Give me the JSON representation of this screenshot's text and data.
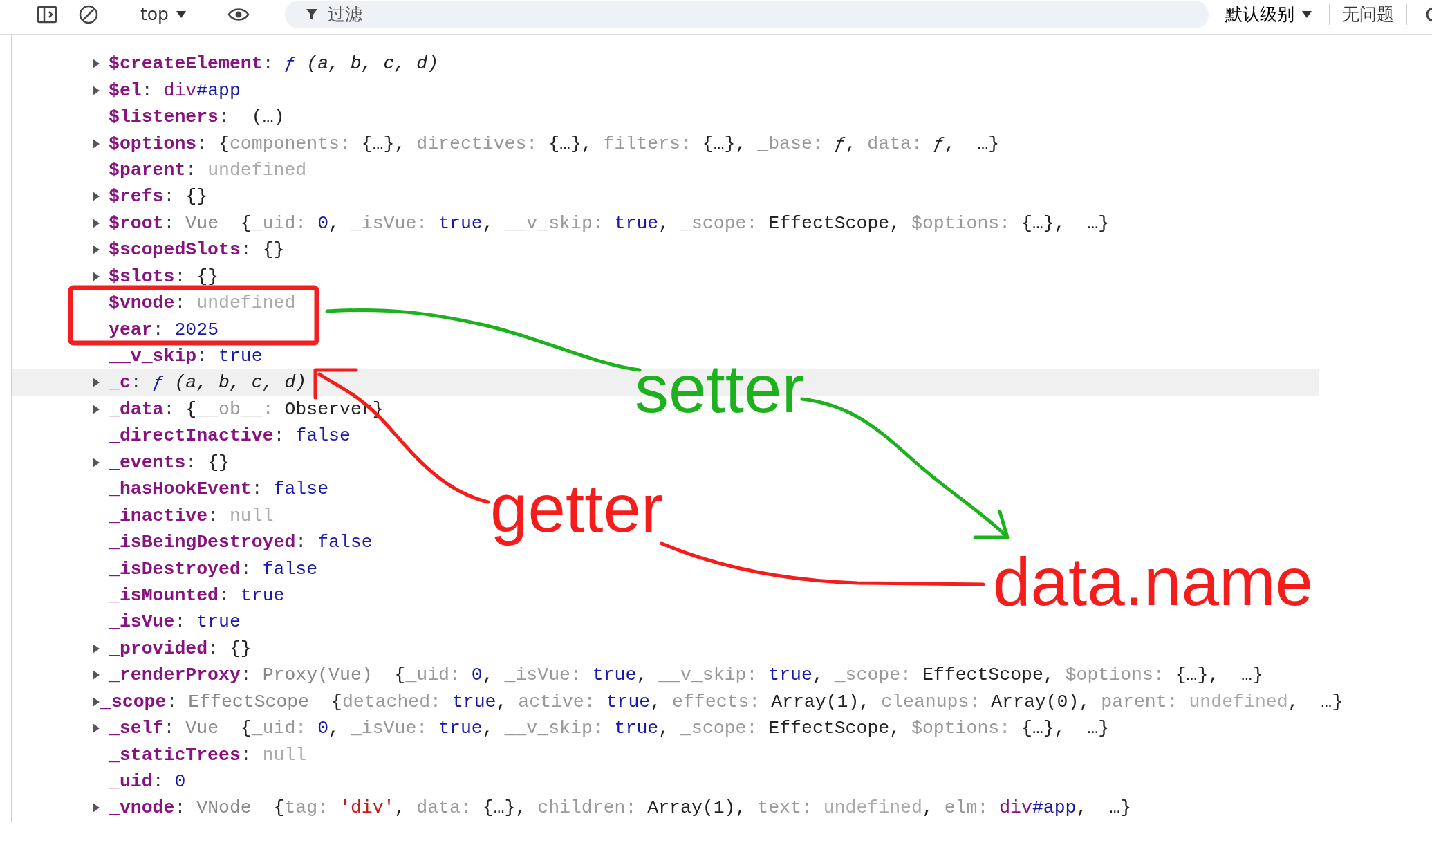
{
  "toolbar": {
    "context": "top",
    "filter_placeholder": "过滤",
    "level": "默认级别",
    "issues": "无问题"
  },
  "rows": [
    {
      "key": "$createElement",
      "expandable": true,
      "highlighted": false,
      "value": [
        {
          "kind": "colon",
          "text": ": "
        },
        {
          "kind": "fn",
          "text": "ƒ"
        },
        {
          "kind": "args",
          "text": " (a, b, c, d)"
        }
      ]
    },
    {
      "key": "$el",
      "expandable": true,
      "highlighted": false,
      "value": [
        {
          "kind": "colon",
          "text": ": "
        },
        {
          "kind": "tag",
          "text": "div"
        },
        {
          "kind": "val",
          "text": "#app"
        }
      ]
    },
    {
      "key": "$listeners",
      "expandable": false,
      "highlighted": false,
      "value": [
        {
          "kind": "colon",
          "text": ": "
        },
        {
          "kind": "obj",
          "text": " (…)"
        }
      ]
    },
    {
      "key": "$options",
      "expandable": true,
      "highlighted": false,
      "value": [
        {
          "kind": "colon",
          "text": ": "
        },
        {
          "kind": "obj",
          "text": "{"
        },
        {
          "kind": "pkey",
          "text": "components: "
        },
        {
          "kind": "obj",
          "text": "{…}, "
        },
        {
          "kind": "pkey",
          "text": "directives: "
        },
        {
          "kind": "obj",
          "text": "{…}, "
        },
        {
          "kind": "pkey",
          "text": "filters: "
        },
        {
          "kind": "obj",
          "text": "{…}, "
        },
        {
          "kind": "pkey",
          "text": "_base: "
        },
        {
          "kind": "fnb",
          "text": "ƒ"
        },
        {
          "kind": "obj",
          "text": ", "
        },
        {
          "kind": "pkey",
          "text": "data: "
        },
        {
          "kind": "fnb",
          "text": "ƒ"
        },
        {
          "kind": "obj",
          "text": ",  …}"
        }
      ]
    },
    {
      "key": "$parent",
      "expandable": false,
      "highlighted": false,
      "value": [
        {
          "kind": "colon",
          "text": ": "
        },
        {
          "kind": "dim",
          "text": "undefined"
        }
      ]
    },
    {
      "key": "$refs",
      "expandable": true,
      "highlighted": false,
      "value": [
        {
          "kind": "colon",
          "text": ": "
        },
        {
          "kind": "obj",
          "text": "{}"
        }
      ]
    },
    {
      "key": "$root",
      "expandable": true,
      "highlighted": false,
      "value": [
        {
          "kind": "colon",
          "text": ": "
        },
        {
          "kind": "cls",
          "text": "Vue  "
        },
        {
          "kind": "obj",
          "text": "{"
        },
        {
          "kind": "pkey",
          "text": "_uid: "
        },
        {
          "kind": "val",
          "text": "0"
        },
        {
          "kind": "obj",
          "text": ", "
        },
        {
          "kind": "pkey",
          "text": "_isVue: "
        },
        {
          "kind": "val",
          "text": "true"
        },
        {
          "kind": "obj",
          "text": ", "
        },
        {
          "kind": "pkey",
          "text": "__v_skip: "
        },
        {
          "kind": "val",
          "text": "true"
        },
        {
          "kind": "obj",
          "text": ", "
        },
        {
          "kind": "pkey",
          "text": "_scope: "
        },
        {
          "kind": "obj",
          "text": "EffectScope, "
        },
        {
          "kind": "pkey",
          "text": "$options: "
        },
        {
          "kind": "obj",
          "text": "{…},  …}"
        }
      ]
    },
    {
      "key": "$scopedSlots",
      "expandable": true,
      "highlighted": false,
      "value": [
        {
          "kind": "colon",
          "text": ": "
        },
        {
          "kind": "obj",
          "text": "{}"
        }
      ]
    },
    {
      "key": "$slots",
      "expandable": true,
      "highlighted": false,
      "value": [
        {
          "kind": "colon",
          "text": ": "
        },
        {
          "kind": "obj",
          "text": "{}"
        }
      ]
    },
    {
      "key": "$vnode",
      "expandable": false,
      "highlighted": false,
      "value": [
        {
          "kind": "colon",
          "text": ": "
        },
        {
          "kind": "dim",
          "text": "undefined"
        }
      ]
    },
    {
      "key": "year",
      "expandable": false,
      "highlighted": false,
      "value": [
        {
          "kind": "colon",
          "text": ": "
        },
        {
          "kind": "val",
          "text": "2025"
        }
      ]
    },
    {
      "key": "__v_skip",
      "expandable": false,
      "highlighted": false,
      "value": [
        {
          "kind": "colon",
          "text": ": "
        },
        {
          "kind": "val",
          "text": "true"
        }
      ]
    },
    {
      "key": "_c",
      "expandable": true,
      "highlighted": true,
      "value": [
        {
          "kind": "colon",
          "text": ": "
        },
        {
          "kind": "fn",
          "text": "ƒ"
        },
        {
          "kind": "args",
          "text": " (a, b, c, d)"
        }
      ]
    },
    {
      "key": "_data",
      "expandable": true,
      "highlighted": false,
      "value": [
        {
          "kind": "colon",
          "text": ": "
        },
        {
          "kind": "obj",
          "text": "{"
        },
        {
          "kind": "pkey",
          "text": "__ob__: "
        },
        {
          "kind": "obj",
          "text": "Observer}"
        }
      ]
    },
    {
      "key": "_directInactive",
      "expandable": false,
      "highlighted": false,
      "value": [
        {
          "kind": "colon",
          "text": ": "
        },
        {
          "kind": "val",
          "text": "false"
        }
      ]
    },
    {
      "key": "_events",
      "expandable": true,
      "highlighted": false,
      "value": [
        {
          "kind": "colon",
          "text": ": "
        },
        {
          "kind": "obj",
          "text": "{}"
        }
      ]
    },
    {
      "key": "_hasHookEvent",
      "expandable": false,
      "highlighted": false,
      "value": [
        {
          "kind": "colon",
          "text": ": "
        },
        {
          "kind": "val",
          "text": "false"
        }
      ]
    },
    {
      "key": "_inactive",
      "expandable": false,
      "highlighted": false,
      "value": [
        {
          "kind": "colon",
          "text": ": "
        },
        {
          "kind": "dim",
          "text": "null"
        }
      ]
    },
    {
      "key": "_isBeingDestroyed",
      "expandable": false,
      "highlighted": false,
      "value": [
        {
          "kind": "colon",
          "text": ": "
        },
        {
          "kind": "val",
          "text": "false"
        }
      ]
    },
    {
      "key": "_isDestroyed",
      "expandable": false,
      "highlighted": false,
      "value": [
        {
          "kind": "colon",
          "text": ": "
        },
        {
          "kind": "val",
          "text": "false"
        }
      ]
    },
    {
      "key": "_isMounted",
      "expandable": false,
      "highlighted": false,
      "value": [
        {
          "kind": "colon",
          "text": ": "
        },
        {
          "kind": "val",
          "text": "true"
        }
      ]
    },
    {
      "key": "_isVue",
      "expandable": false,
      "highlighted": false,
      "value": [
        {
          "kind": "colon",
          "text": ": "
        },
        {
          "kind": "val",
          "text": "true"
        }
      ]
    },
    {
      "key": "_provided",
      "expandable": true,
      "highlighted": false,
      "value": [
        {
          "kind": "colon",
          "text": ": "
        },
        {
          "kind": "obj",
          "text": "{}"
        }
      ]
    },
    {
      "key": "_renderProxy",
      "expandable": true,
      "highlighted": false,
      "value": [
        {
          "kind": "colon",
          "text": ": "
        },
        {
          "kind": "cls",
          "text": "Proxy(Vue)  "
        },
        {
          "kind": "obj",
          "text": "{"
        },
        {
          "kind": "pkey",
          "text": "_uid: "
        },
        {
          "kind": "val",
          "text": "0"
        },
        {
          "kind": "obj",
          "text": ", "
        },
        {
          "kind": "pkey",
          "text": "_isVue: "
        },
        {
          "kind": "val",
          "text": "true"
        },
        {
          "kind": "obj",
          "text": ", "
        },
        {
          "kind": "pkey",
          "text": "__v_skip: "
        },
        {
          "kind": "val",
          "text": "true"
        },
        {
          "kind": "obj",
          "text": ", "
        },
        {
          "kind": "pkey",
          "text": "_scope: "
        },
        {
          "kind": "obj",
          "text": "EffectScope, "
        },
        {
          "kind": "pkey",
          "text": "$options: "
        },
        {
          "kind": "obj",
          "text": "{…},  …}"
        }
      ]
    },
    {
      "key": "_scope",
      "expandable": true,
      "highlighted": false,
      "value": [
        {
          "kind": "colon",
          "text": ": "
        },
        {
          "kind": "cls",
          "text": "EffectScope  "
        },
        {
          "kind": "obj",
          "text": "{"
        },
        {
          "kind": "pkey",
          "text": "detached: "
        },
        {
          "kind": "val",
          "text": "true"
        },
        {
          "kind": "obj",
          "text": ", "
        },
        {
          "kind": "pkey",
          "text": "active: "
        },
        {
          "kind": "val",
          "text": "true"
        },
        {
          "kind": "obj",
          "text": ", "
        },
        {
          "kind": "pkey",
          "text": "effects: "
        },
        {
          "kind": "obj",
          "text": "Array(1), "
        },
        {
          "kind": "pkey",
          "text": "cleanups: "
        },
        {
          "kind": "obj",
          "text": "Array(0), "
        },
        {
          "kind": "pkey",
          "text": "parent: "
        },
        {
          "kind": "dim",
          "text": "undefined"
        },
        {
          "kind": "obj",
          "text": ",  …}"
        }
      ]
    },
    {
      "key": "_self",
      "expandable": true,
      "highlighted": false,
      "value": [
        {
          "kind": "colon",
          "text": ": "
        },
        {
          "kind": "cls",
          "text": "Vue  "
        },
        {
          "kind": "obj",
          "text": "{"
        },
        {
          "kind": "pkey",
          "text": "_uid: "
        },
        {
          "kind": "val",
          "text": "0"
        },
        {
          "kind": "obj",
          "text": ", "
        },
        {
          "kind": "pkey",
          "text": "_isVue: "
        },
        {
          "kind": "val",
          "text": "true"
        },
        {
          "kind": "obj",
          "text": ", "
        },
        {
          "kind": "pkey",
          "text": "__v_skip: "
        },
        {
          "kind": "val",
          "text": "true"
        },
        {
          "kind": "obj",
          "text": ", "
        },
        {
          "kind": "pkey",
          "text": "_scope: "
        },
        {
          "kind": "obj",
          "text": "EffectScope, "
        },
        {
          "kind": "pkey",
          "text": "$options: "
        },
        {
          "kind": "obj",
          "text": "{…},  …}"
        }
      ]
    },
    {
      "key": "_staticTrees",
      "expandable": false,
      "highlighted": false,
      "value": [
        {
          "kind": "colon",
          "text": ": "
        },
        {
          "kind": "dim",
          "text": "null"
        }
      ]
    },
    {
      "key": "_uid",
      "expandable": false,
      "highlighted": false,
      "value": [
        {
          "kind": "colon",
          "text": ": "
        },
        {
          "kind": "val",
          "text": "0"
        }
      ]
    },
    {
      "key": "_vnode",
      "expandable": true,
      "highlighted": false,
      "value": [
        {
          "kind": "colon",
          "text": ": "
        },
        {
          "kind": "cls",
          "text": "VNode  "
        },
        {
          "kind": "obj",
          "text": "{"
        },
        {
          "kind": "pkey",
          "text": "tag: "
        },
        {
          "kind": "str",
          "text": "'div'"
        },
        {
          "kind": "obj",
          "text": ", "
        },
        {
          "kind": "pkey",
          "text": "data: "
        },
        {
          "kind": "obj",
          "text": "{…}, "
        },
        {
          "kind": "pkey",
          "text": "children: "
        },
        {
          "kind": "obj",
          "text": "Array(1), "
        },
        {
          "kind": "pkey",
          "text": "text: "
        },
        {
          "kind": "dim",
          "text": "undefined"
        },
        {
          "kind": "obj",
          "text": ", "
        },
        {
          "kind": "pkey",
          "text": "elm: "
        },
        {
          "kind": "tag",
          "text": "div"
        },
        {
          "kind": "val",
          "text": "#app"
        },
        {
          "kind": "obj",
          "text": ",  …}"
        }
      ]
    }
  ],
  "annotations": {
    "frame": {
      "color": "#f02020"
    },
    "labels": [
      {
        "text": "setter",
        "color": "#1db21d"
      },
      {
        "text": "getter",
        "color": "#f51c1c"
      },
      {
        "text": "data.name",
        "color": "#f51c1c"
      }
    ],
    "arrows": [
      {
        "color": "#1db21d"
      },
      {
        "color": "#1db21d"
      },
      {
        "color": "#f51c1c"
      },
      {
        "color": "#f51c1c"
      }
    ]
  }
}
